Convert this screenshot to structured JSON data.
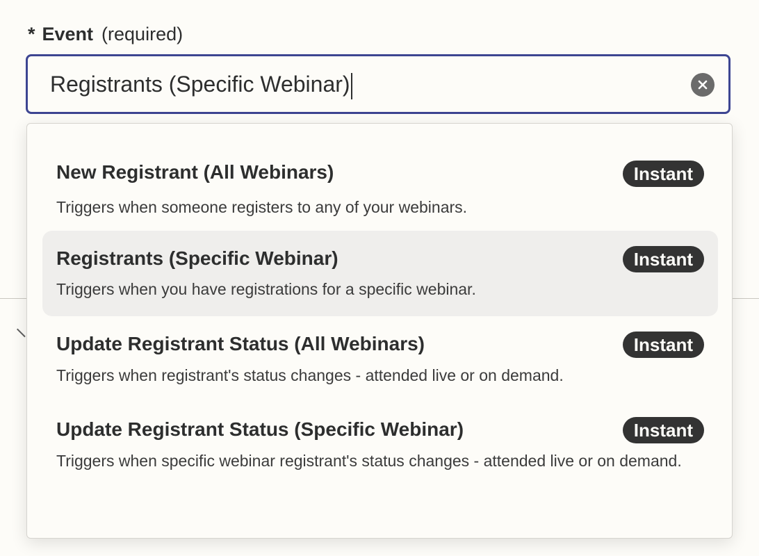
{
  "field": {
    "required_marker": "*",
    "label": "Event",
    "hint": "(required)",
    "value": "Registrants (Specific Webinar)"
  },
  "clear_icon": "close-circle-icon",
  "options": [
    {
      "title": "New Registrant (All Webinars)",
      "description": "Triggers when someone registers to any of your webinars.",
      "badge": "Instant",
      "highlighted": false
    },
    {
      "title": "Registrants (Specific Webinar)",
      "description": "Triggers when you have registrations for a specific webinar.",
      "badge": "Instant",
      "highlighted": true
    },
    {
      "title": "Update Registrant Status (All Webinars)",
      "description": "Triggers when registrant's status changes - attended live or on demand.",
      "badge": "Instant",
      "highlighted": false
    },
    {
      "title": "Update Registrant Status (Specific Webinar)",
      "description": "Triggers when specific webinar registrant's status changes - attended live or on demand.",
      "badge": "Instant",
      "highlighted": false
    }
  ],
  "colors": {
    "focus_border": "#3d4592",
    "badge_bg": "#333333",
    "highlight_bg": "#efeeec"
  }
}
